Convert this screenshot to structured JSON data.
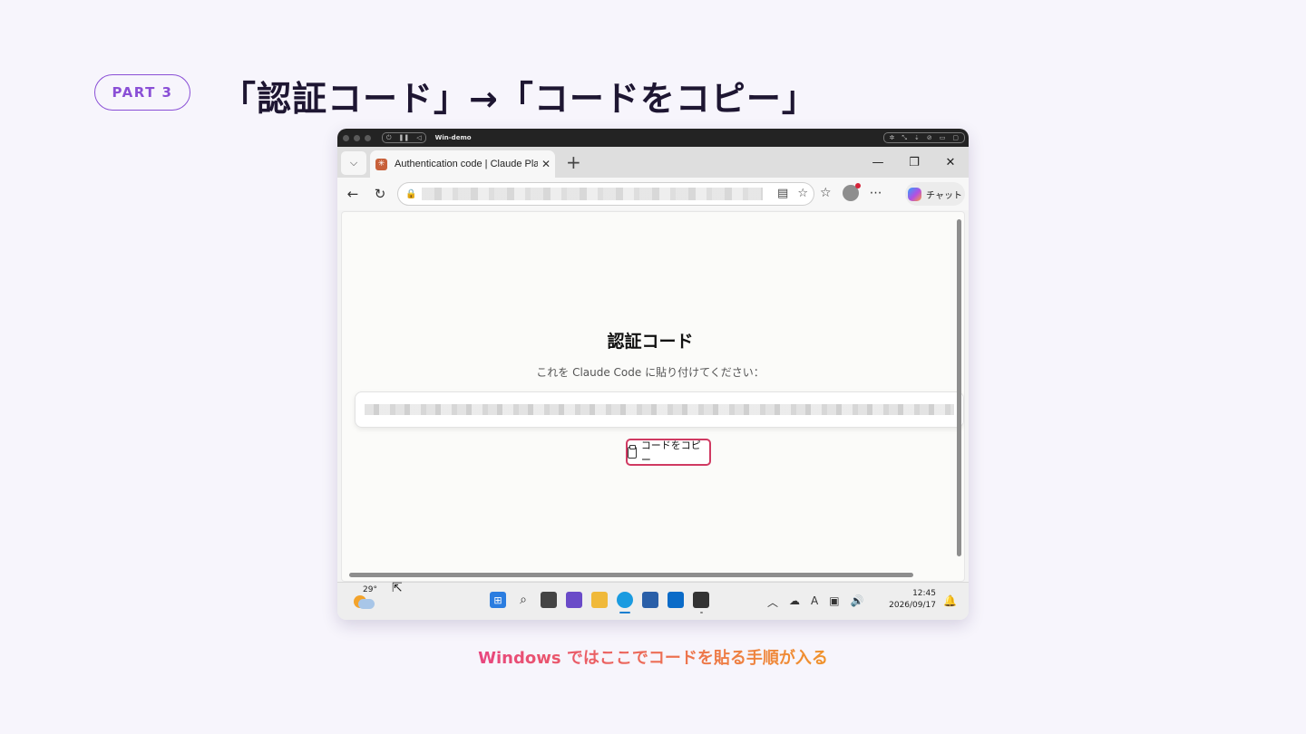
{
  "slide": {
    "part_label": "PART 3",
    "title": "「認証コード」→「コードをコピー」",
    "caption": "Windows ではここでコードを貼る手順が入る"
  },
  "vm": {
    "window_name": "Win-demo"
  },
  "browser": {
    "tab_title": "Authentication code | Claude Platform",
    "tab_close": "✕",
    "new_tab": "+",
    "copilot_label": "チャット",
    "window_controls": {
      "minimize": "—",
      "restore": "❐",
      "close": "✕"
    }
  },
  "page": {
    "heading": "認証コード",
    "instruction": "これを Claude Code に貼り付けてください：",
    "copy_button_label": "コードをコピー"
  },
  "taskbar": {
    "temperature": "29°",
    "time": "12:45",
    "date": "2026/09/17"
  },
  "colors": {
    "accent_purple": "#8a4fd6",
    "copy_button_border": "#d03a62",
    "caption_start": "#e8467f",
    "caption_end": "#f0932b"
  }
}
